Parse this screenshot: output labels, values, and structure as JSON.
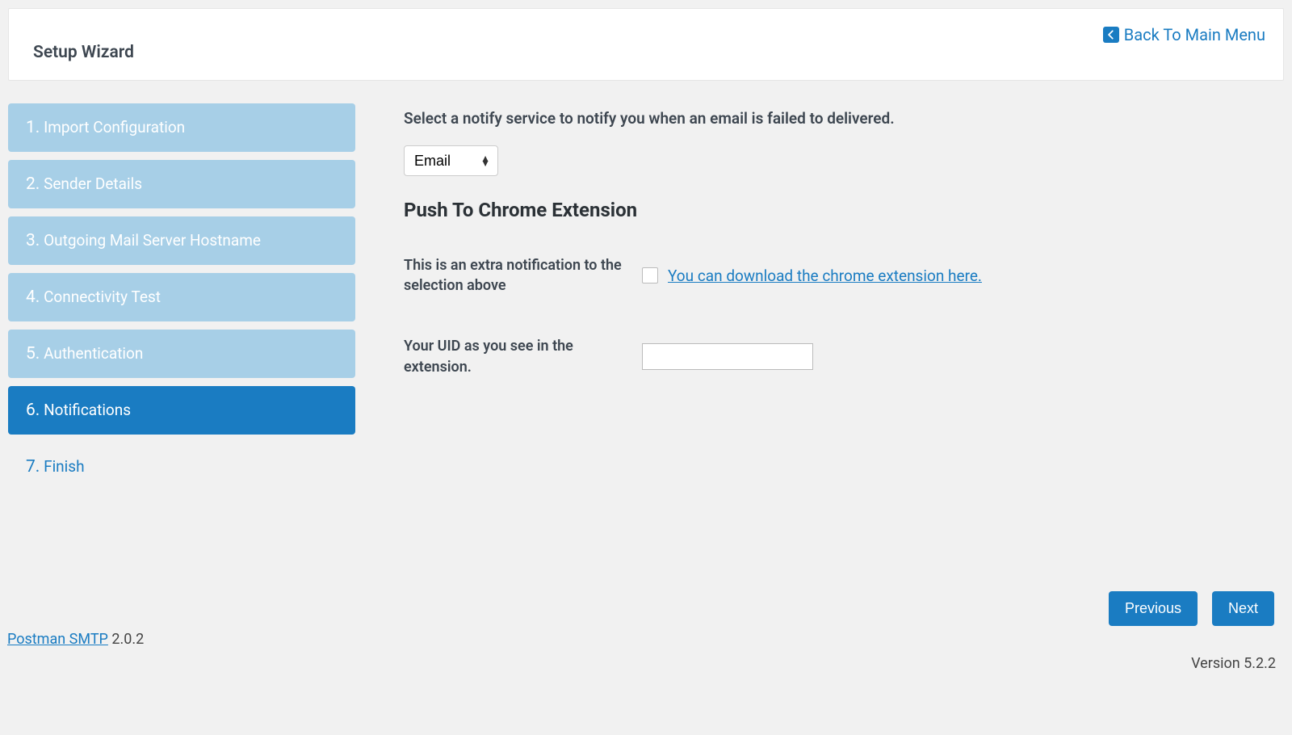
{
  "header": {
    "title": "Setup Wizard",
    "back_label": "Back To Main Menu"
  },
  "sidebar": {
    "steps": [
      {
        "num": "1.",
        "label": "Import Configuration",
        "state": "inactive"
      },
      {
        "num": "2.",
        "label": "Sender Details",
        "state": "inactive"
      },
      {
        "num": "3.",
        "label": "Outgoing Mail Server Hostname",
        "state": "inactive"
      },
      {
        "num": "4.",
        "label": "Connectivity Test",
        "state": "inactive"
      },
      {
        "num": "5.",
        "label": "Authentication",
        "state": "inactive"
      },
      {
        "num": "6.",
        "label": "Notifications",
        "state": "active"
      },
      {
        "num": "7.",
        "label": "Finish",
        "state": "upcoming"
      }
    ]
  },
  "content": {
    "instruction": "Select a notify service to notify you when an email is failed to delivered.",
    "select_value": "Email",
    "section_heading": "Push To Chrome Extension",
    "extra_label": "This is an extra notification to the selection above",
    "download_link": "You can download the chrome extension here.",
    "uid_label": "Your UID as you see in the extension.",
    "uid_value": ""
  },
  "nav": {
    "prev": "Previous",
    "next": "Next"
  },
  "footer": {
    "plugin_name": "Postman SMTP",
    "plugin_version": " 2.0.2",
    "wp_version": "Version 5.2.2"
  }
}
